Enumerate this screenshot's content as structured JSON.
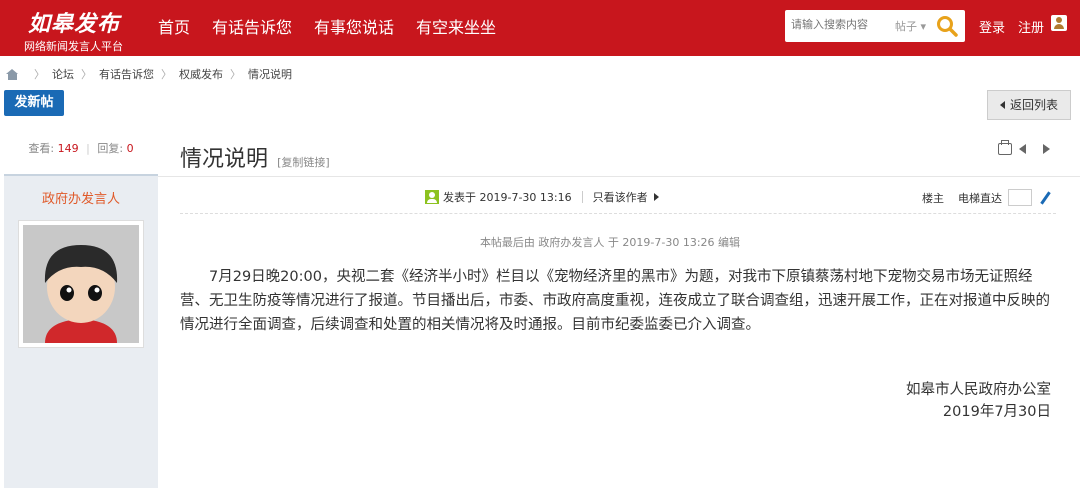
{
  "header": {
    "logo_title": "如皋发布",
    "logo_subtitle": "网络新闻发言人平台",
    "nav": [
      {
        "label": "首页"
      },
      {
        "label": "有话告诉您"
      },
      {
        "label": "有事您说话"
      },
      {
        "label": "有空来坐坐"
      }
    ],
    "search": {
      "placeholder": "请输入搜索内容",
      "type": "帖子 ▾"
    },
    "login": "登录",
    "register": "注册"
  },
  "breadcrumb": [
    "论坛",
    "有话告诉您",
    "权威发布",
    "情况说明"
  ],
  "actions": {
    "new_post": "发新帖",
    "back_to_list": "返回列表"
  },
  "stats": {
    "views_label": "查看:",
    "views": "149",
    "replies_label": "回复:",
    "replies": "0"
  },
  "post": {
    "author": "政府办发言人",
    "title": "情况说明",
    "copy_link": "[复制链接]",
    "posted_at": "发表于 2019-7-30 13:16",
    "author_only": "只看该作者",
    "floor": "楼主",
    "jump_label": "电梯直达",
    "edit_note": "本帖最后由 政府办发言人 于 2019-7-30 13:26 编辑",
    "body": "7月29日晚20:00，央视二套《经济半小时》栏目以《宠物经济里的黑市》为题，对我市下原镇蔡荡村地下宠物交易市场无证照经营、无卫生防疫等情况进行了报道。节目播出后，市委、市政府高度重视，连夜成立了联合调查组，迅速开展工作，正在对报道中反映的情况进行全面调查，后续调查和处置的相关情况将及时通报。目前市纪委监委已介入调查。",
    "signature_org": "如皋市人民政府办公室",
    "signature_date": "2019年7月30日"
  },
  "colors": {
    "brand_red": "#c8161d",
    "button_blue": "#1a6ab5",
    "accent_orange": "#e05a2a"
  }
}
